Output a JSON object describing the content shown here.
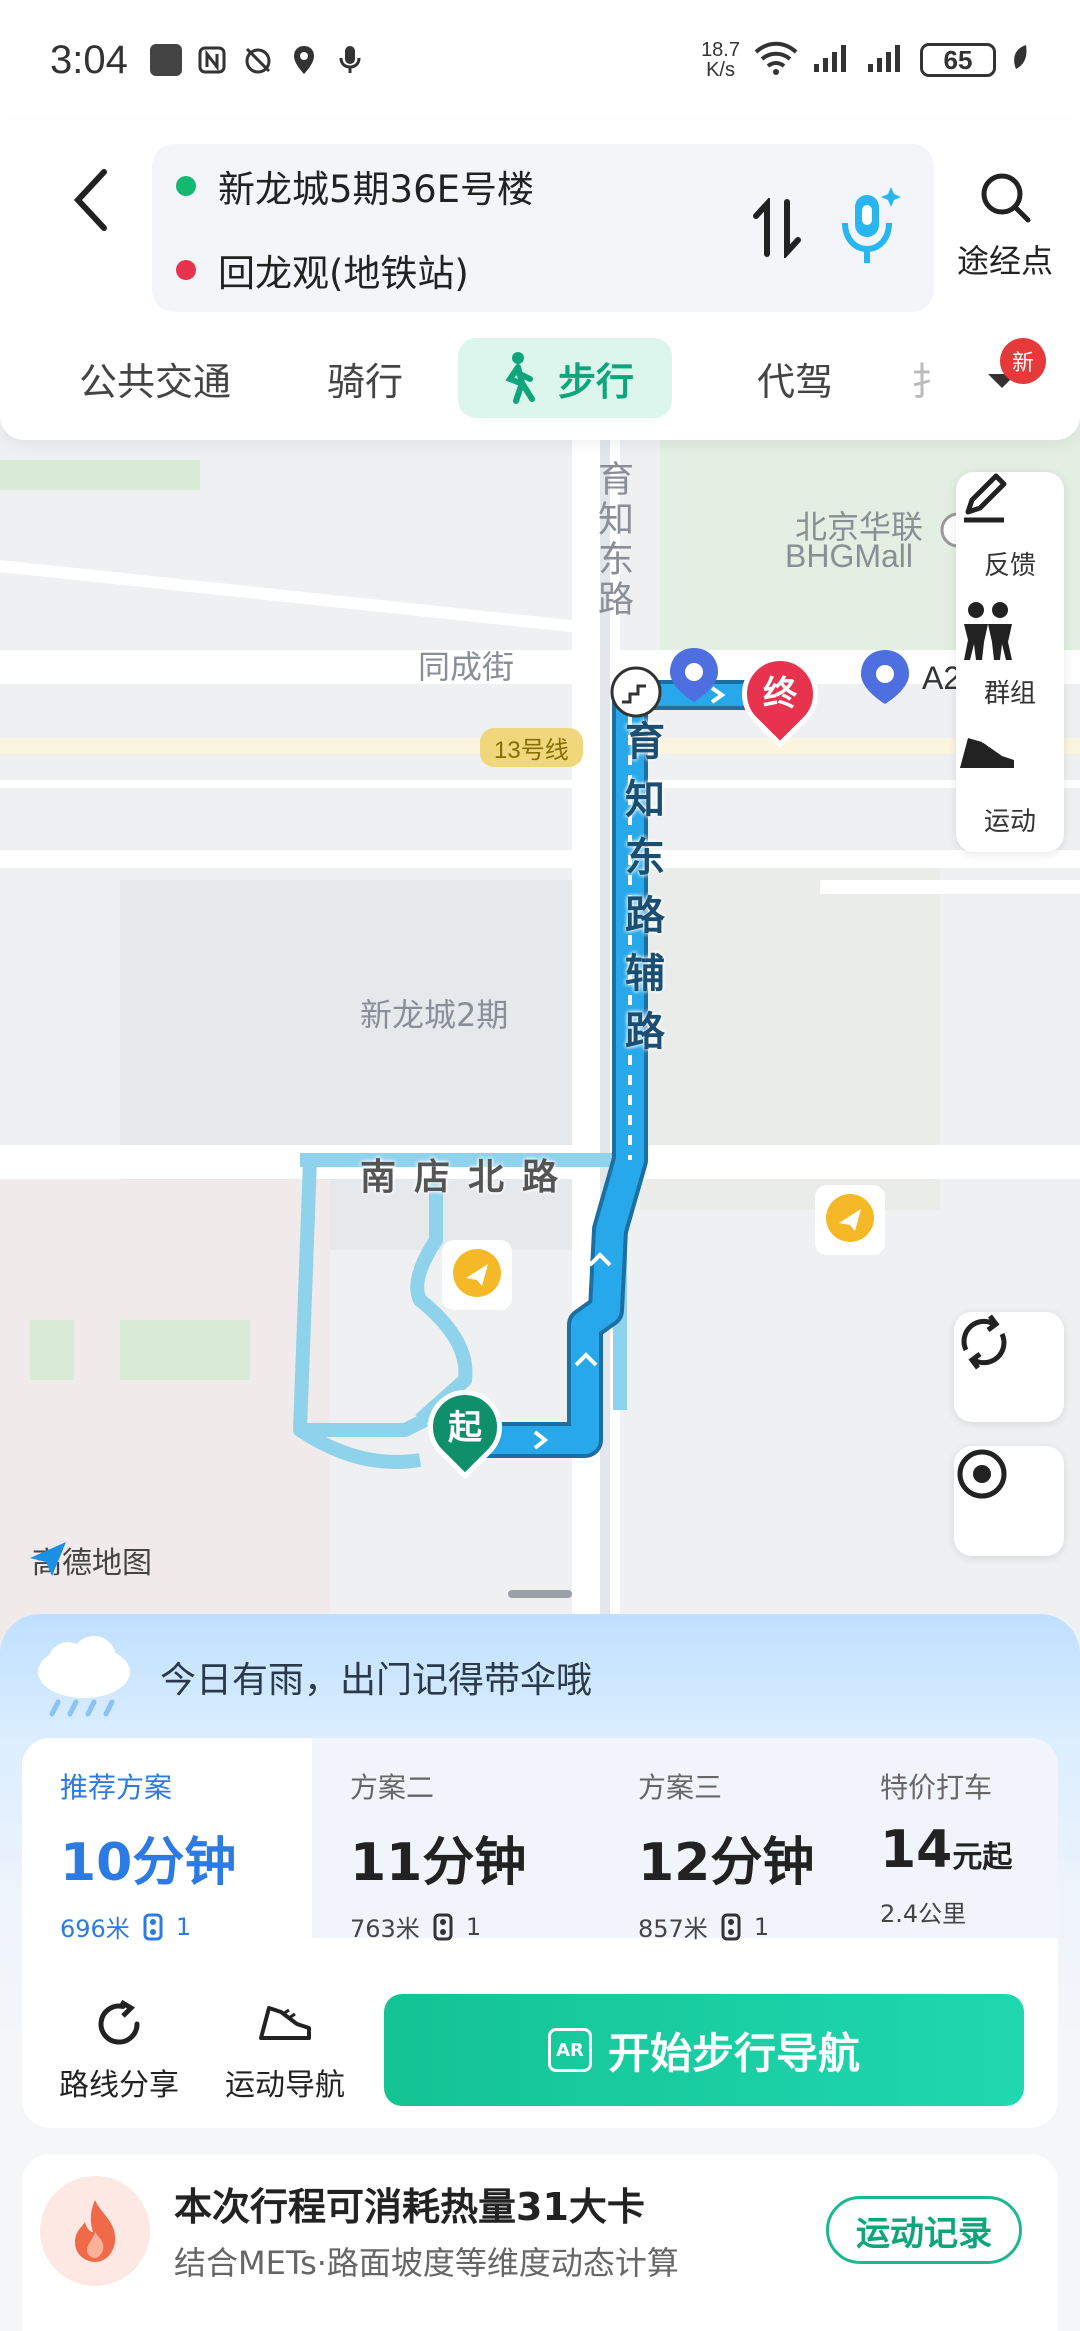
{
  "status": {
    "time": "3:04",
    "net_speed_top": "18.7",
    "net_speed_bottom": "K/s",
    "battery": "65"
  },
  "header": {
    "start": "新龙城5期36E号楼",
    "end": "回龙观(地铁站)",
    "waypoint_label": "途经点"
  },
  "tabs": [
    {
      "label": "公共交通"
    },
    {
      "label": "骑行"
    },
    {
      "label": "步行"
    },
    {
      "label": "代驾"
    },
    {
      "label": "扌"
    }
  ],
  "new_badge": "新",
  "map": {
    "labels": {
      "tongcheng": "同成街",
      "xinlongcheng": "新龙城2期",
      "huilian_cn": "北京华联",
      "huilian_en": "BHGMall",
      "a2": "A2",
      "yuzhi_top": "育知东路",
      "route_road": "育知东路辅路",
      "nandian": "南店北路",
      "line13": "13号线"
    },
    "pin_end": "终",
    "pin_start": "起",
    "logo": "高德地图",
    "side_panel": [
      {
        "label": "反馈",
        "icon": "feedback-icon"
      },
      {
        "label": "群组",
        "icon": "group-icon"
      },
      {
        "label": "运动",
        "icon": "sport-icon"
      }
    ]
  },
  "sheet": {
    "weather": "今日有雨，出门记得带伞哦",
    "plans": [
      {
        "name": "推荐方案",
        "time": "10分钟",
        "distance": "696米",
        "lights": "1"
      },
      {
        "name": "方案二",
        "time": "11分钟",
        "distance": "763米",
        "lights": "1"
      },
      {
        "name": "方案三",
        "time": "12分钟",
        "distance": "857米",
        "lights": "1"
      },
      {
        "name": "特价打车",
        "time": "14",
        "time_unit": "元起",
        "distance": "2.4公里"
      }
    ],
    "actions": {
      "share": "路线分享",
      "sport_nav": "运动导航",
      "start": "开始步行导航",
      "ar": "AR"
    },
    "calorie": {
      "title": "本次行程可消耗热量31大卡",
      "subtitle": "结合METs·路面坡度等维度动态计算",
      "button": "运动记录"
    }
  },
  "colors": {
    "accent": "#14c394",
    "route": "#1ea0e0",
    "plan_active": "#2c7be5",
    "end_pin": "#e8334f",
    "start_pin": "#0f8f6a"
  }
}
